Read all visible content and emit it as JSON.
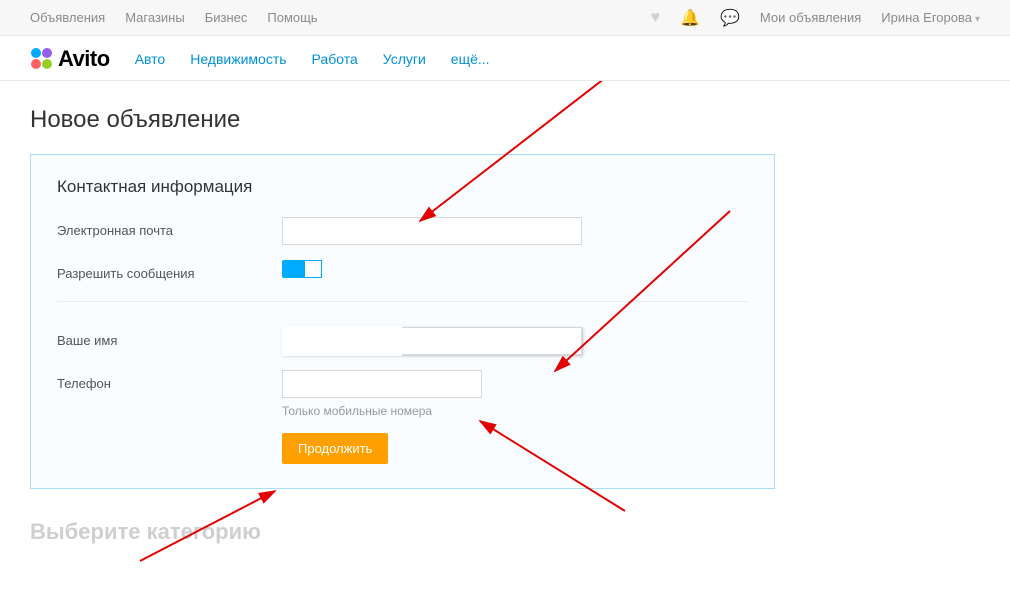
{
  "topbar": {
    "left": [
      "Объявления",
      "Магазины",
      "Бизнес",
      "Помощь"
    ],
    "my_ads": "Мои объявления",
    "user": "Ирина Егорова"
  },
  "header": {
    "logo": "Avito",
    "categories": [
      "Авто",
      "Недвижимость",
      "Работа",
      "Услуги",
      "ещё..."
    ]
  },
  "page": {
    "title": "Новое объявление",
    "panel_title": "Контактная информация",
    "email_label": "Электронная почта",
    "allow_label": "Разрешить сообщения",
    "name_label": "Ваше имя",
    "phone_label": "Телефон",
    "phone_hint": "Только мобильные номера",
    "continue": "Продолжить",
    "next_section": "Выберите категорию"
  }
}
